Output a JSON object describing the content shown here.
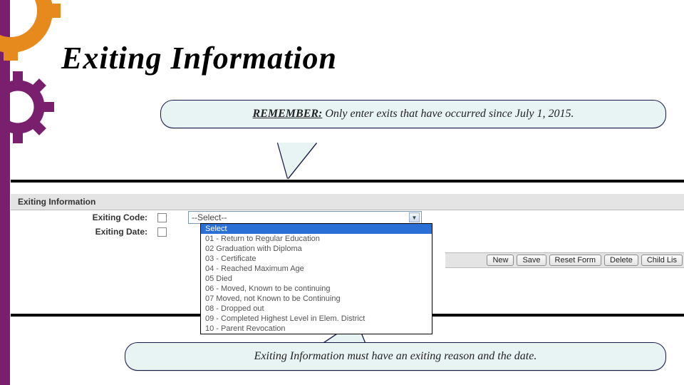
{
  "title": "Exiting Information",
  "callout_top": {
    "label": "REMEMBER:",
    "text": "  Only enter exits that have occurred since July 1, 2015."
  },
  "callout_bottom": "Exiting Information must have an exiting reason and the date.",
  "form": {
    "heading": "Exiting Information",
    "code_label": "Exiting Code:",
    "date_label": "Exiting Date:",
    "code_value": "--Select--",
    "options": [
      "Select",
      "01 - Return to Regular Education",
      "02   Graduation with Diploma",
      "03 - Certificate",
      "04 - Reached Maximum Age",
      "05   Died",
      "06 - Moved, Known to be continuing",
      "07   Moved, not Known to be Continuing",
      "08 - Dropped out",
      "09 - Completed Highest Level in Elem. District",
      "10 - Parent Revocation"
    ]
  },
  "buttons": [
    "New",
    "Save",
    "Reset Form",
    "Delete",
    "Child Lis"
  ]
}
